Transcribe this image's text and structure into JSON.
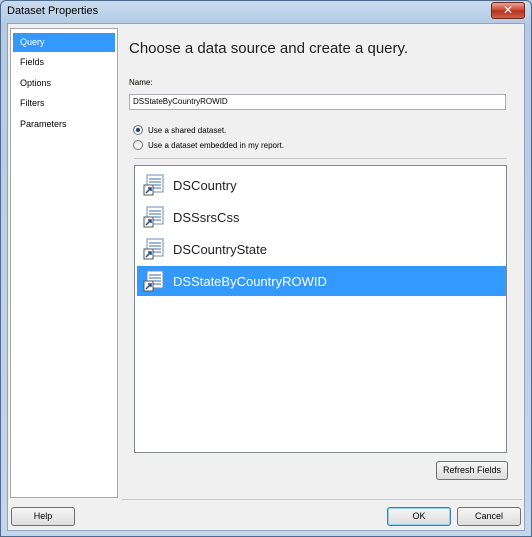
{
  "window": {
    "title": "Dataset Properties",
    "close_glyph": "✕"
  },
  "nav": {
    "items": [
      {
        "label": "Query",
        "selected": true
      },
      {
        "label": "Fields",
        "selected": false
      },
      {
        "label": "Options",
        "selected": false
      },
      {
        "label": "Filters",
        "selected": false
      },
      {
        "label": "Parameters",
        "selected": false
      }
    ]
  },
  "main": {
    "heading": "Choose a data source and create a query.",
    "name_label": "Name:",
    "name_value": "DSStateByCountryROWID",
    "radio_shared": {
      "label": "Use a shared dataset.",
      "checked": true
    },
    "radio_embedded": {
      "label": "Use a dataset embedded in my report.",
      "checked": false
    },
    "datasets": [
      {
        "label": "DSCountry",
        "selected": false
      },
      {
        "label": "DSSsrsCss",
        "selected": false
      },
      {
        "label": "DSCountryState",
        "selected": false
      },
      {
        "label": "DSStateByCountryROWID",
        "selected": true
      }
    ],
    "refresh_label": "Refresh Fields"
  },
  "footer": {
    "help_label": "Help",
    "ok_label": "OK",
    "cancel_label": "Cancel"
  },
  "colors": {
    "selection": "#3399ff",
    "icon_blue": "#2a5f9e"
  }
}
